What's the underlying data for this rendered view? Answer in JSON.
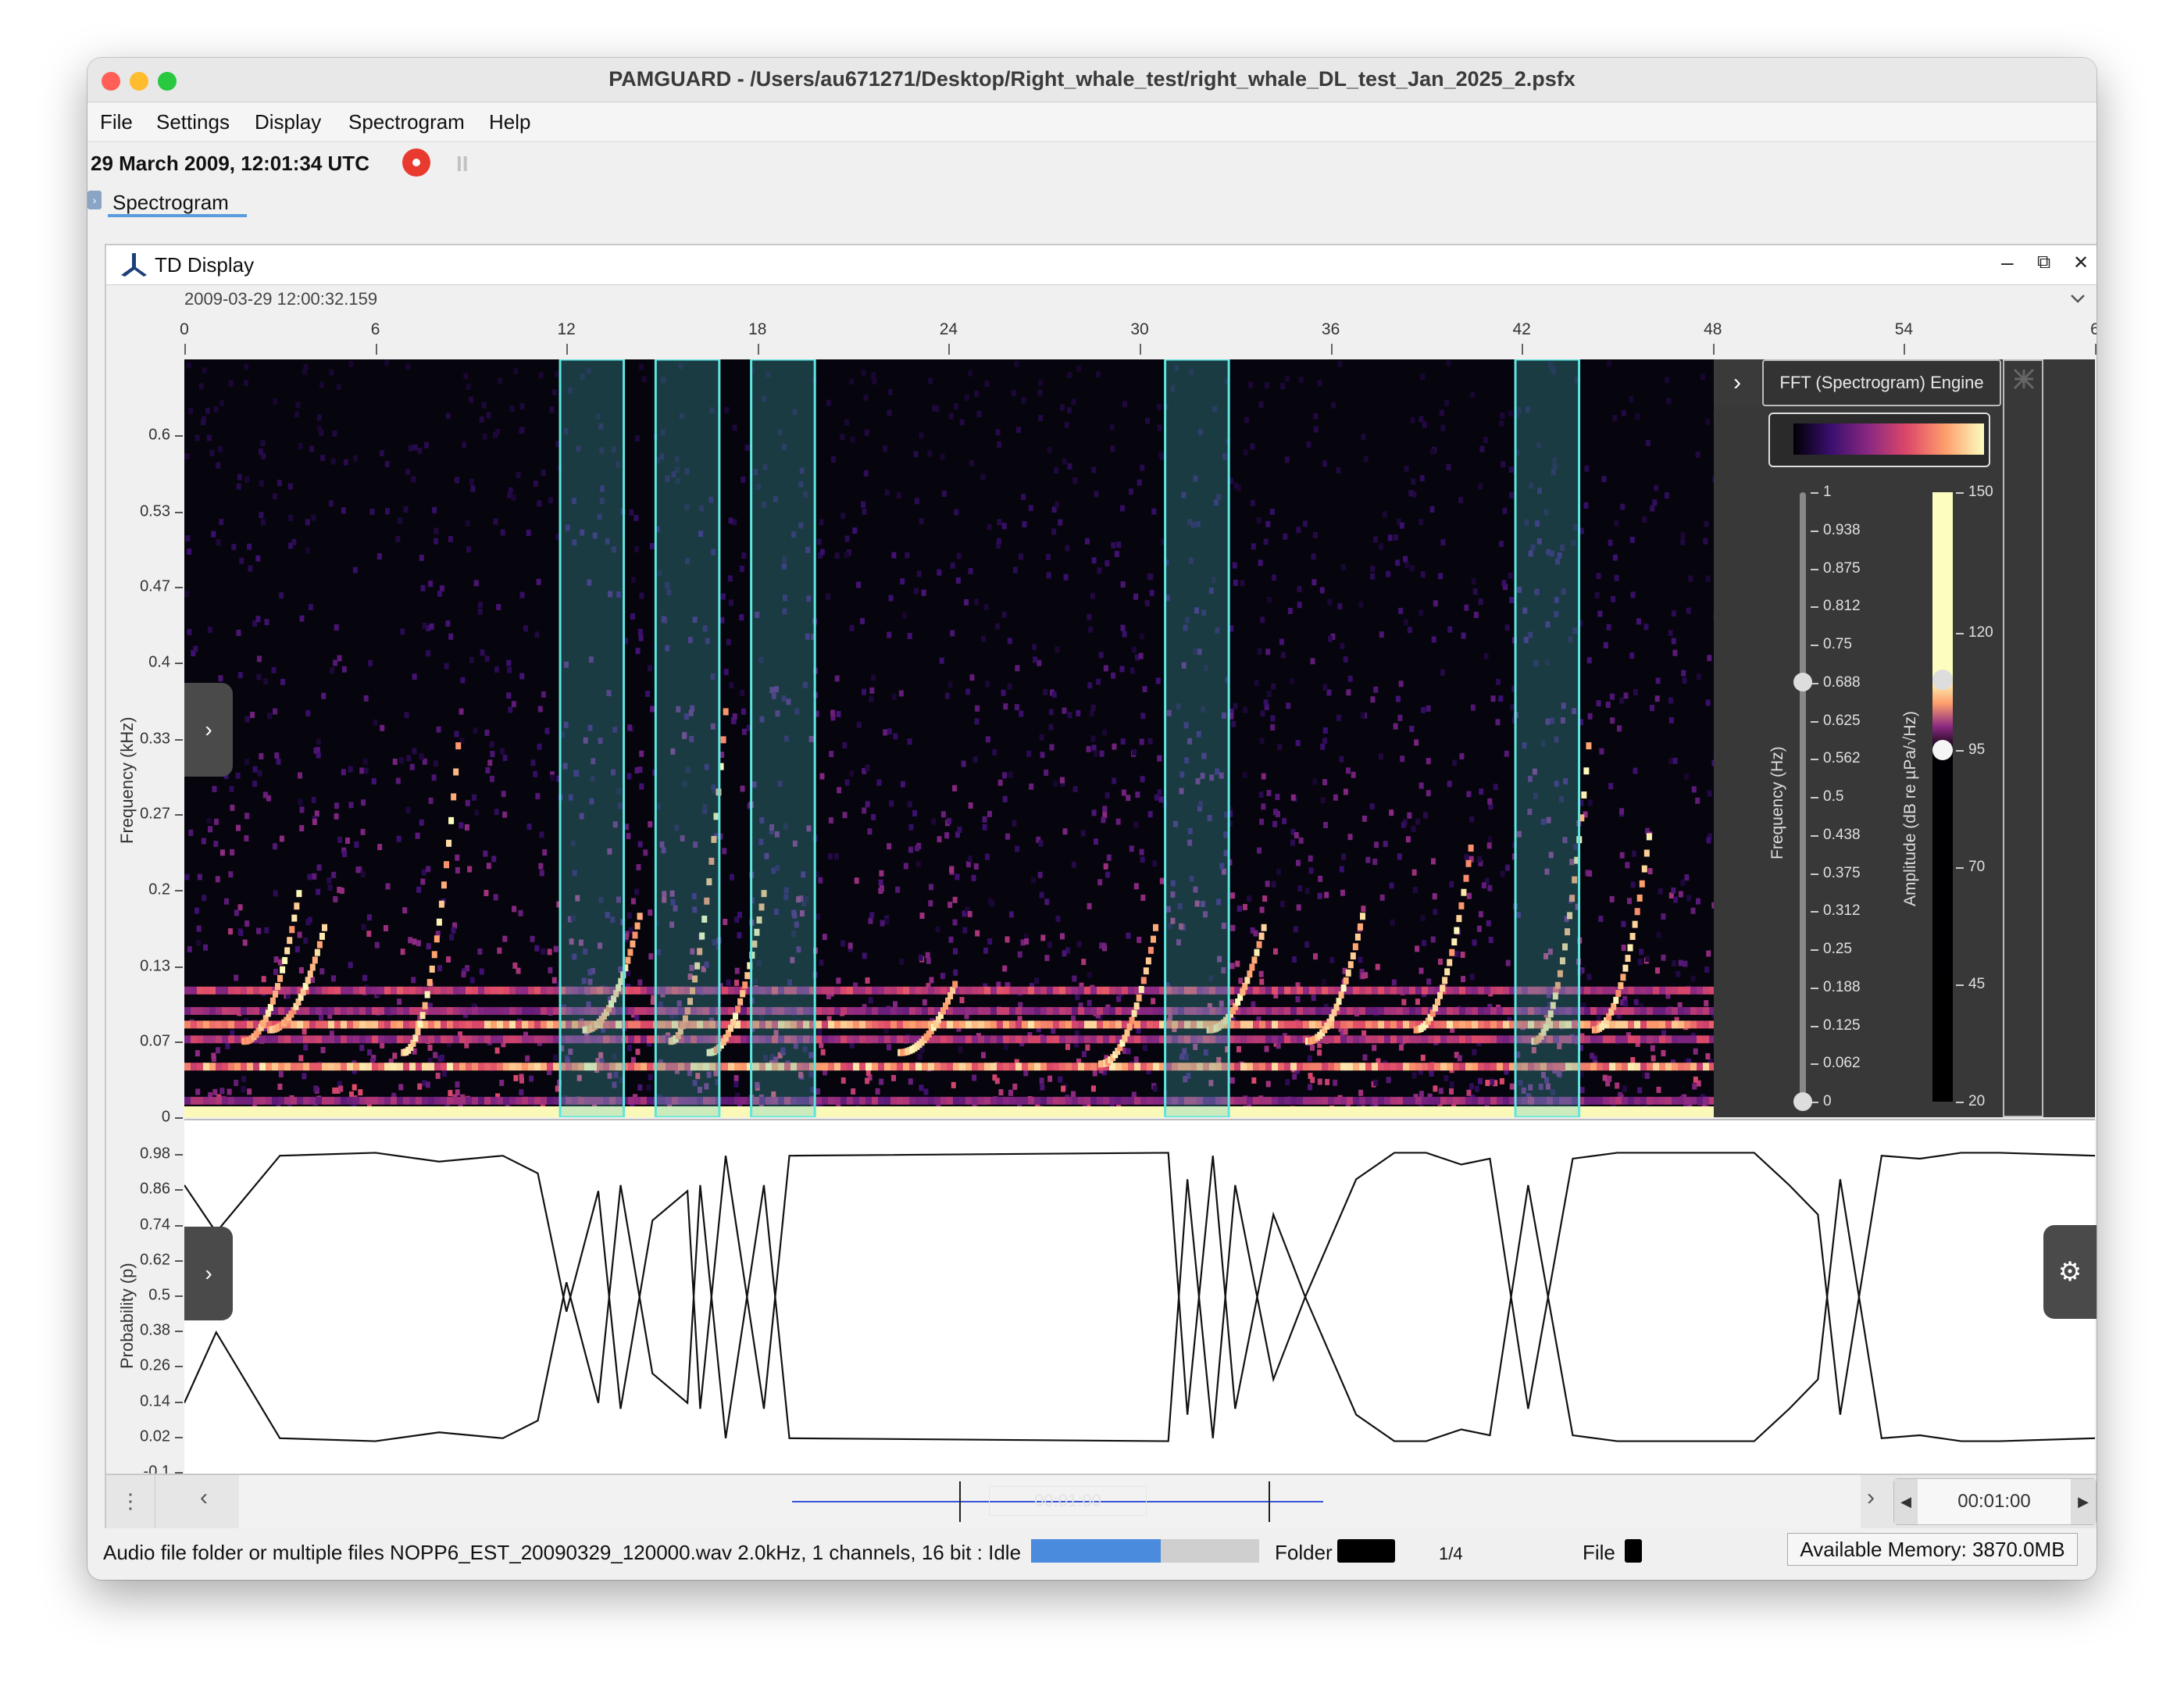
{
  "window": {
    "title": "PAMGUARD - /Users/au671271/Desktop/Right_whale_test/right_whale_DL_test_Jan_2025_2.psfx",
    "traffic_lights": {
      "close": "#ff5f57",
      "minimize": "#febc2e",
      "zoom": "#28c840"
    }
  },
  "menu": [
    "File",
    "Settings",
    "Display",
    "Spectrogram",
    "Help"
  ],
  "toolbar": {
    "datetime": "29 March 2009, 12:01:34 UTC",
    "record_icon": "record-icon",
    "pause_icon": "pause-icon",
    "pause_label": "II"
  },
  "tabs": [
    {
      "label": "Spectrogram",
      "active": true
    }
  ],
  "td_display": {
    "title": "TD Display",
    "start_time": "2009-03-29 12:00:32.159",
    "minimize": "–",
    "restore": "⧉",
    "close": "✕",
    "collapse_icon": "chevron-down-icon",
    "time_ticks": [
      0,
      6,
      12,
      18,
      24,
      30,
      36,
      42,
      48,
      54,
      6
    ],
    "time_tick_positions": [
      0,
      6,
      12,
      18,
      24,
      30,
      36,
      42,
      48,
      54,
      60
    ]
  },
  "spectrogram": {
    "y_label": "Frequency (kHz)",
    "y_ticks": [
      "0.6",
      "0.53",
      "0.47",
      "0.4",
      "0.33",
      "0.27",
      "0.2",
      "0.13",
      "0.07",
      "0"
    ],
    "y_tick_values": [
      0.6,
      0.533,
      0.467,
      0.4,
      0.333,
      0.267,
      0.2,
      0.133,
      0.067,
      0
    ],
    "y_max": 0.667,
    "time_max": 60,
    "detections_s": [
      [
        11.8,
        13.8
      ],
      [
        14.8,
        16.8
      ],
      [
        17.8,
        19.8
      ],
      [
        30.8,
        32.8
      ],
      [
        41.8,
        43.8
      ]
    ],
    "detection_color": "#5ee6e0",
    "colormap": [
      "#000004",
      "#3b0f70",
      "#8c2981",
      "#de4968",
      "#fe9f6d",
      "#fcfdbf"
    ]
  },
  "engine_panel": {
    "title": "FFT (Spectrogram) Engine",
    "expand_icon": "chevron-right-icon",
    "handle_icon": "drag-handle-icon",
    "freq_label": "Frequency (Hz)",
    "freq_ticks": [
      "1",
      "0.938",
      "0.875",
      "0.812",
      "0.75",
      "0.688",
      "0.625",
      "0.562",
      "0.5",
      "0.438",
      "0.375",
      "0.312",
      "0.25",
      "0.188",
      "0.125",
      "0.062",
      "0"
    ],
    "freq_slider_value": 0.688,
    "amp_label": "Amplitude (dB re µPa/√Hz)",
    "amp_ticks": [
      "150",
      "120",
      "95",
      "70",
      "45",
      "20"
    ],
    "amp_tick_values": [
      150,
      120,
      95,
      70,
      45,
      20
    ],
    "amp_high": 110,
    "amp_low": 95
  },
  "probability": {
    "y_label": "Probability (p)",
    "y_ticks": [
      "0.98",
      "0.86",
      "0.74",
      "0.62",
      "0.5",
      "0.38",
      "0.26",
      "0.14",
      "0.02",
      "-0.1"
    ],
    "y_tick_values": [
      0.98,
      0.86,
      0.74,
      0.62,
      0.5,
      0.38,
      0.26,
      0.14,
      0.02,
      -0.1
    ],
    "y_range": [
      -0.1,
      1.1
    ],
    "gear_icon": "gear-icon",
    "side_icon": "chevron-right-icon",
    "upper": [
      [
        0,
        0.88
      ],
      [
        1,
        0.72
      ],
      [
        3,
        0.98
      ],
      [
        6,
        0.99
      ],
      [
        8,
        0.96
      ],
      [
        10,
        0.98
      ],
      [
        11.1,
        0.92
      ],
      [
        12,
        0.45
      ],
      [
        13,
        0.86
      ],
      [
        13.7,
        0.12
      ],
      [
        14.7,
        0.76
      ],
      [
        15.8,
        0.86
      ],
      [
        16.2,
        0.12
      ],
      [
        17,
        0.98
      ],
      [
        18.2,
        0.12
      ],
      [
        19,
        0.98
      ],
      [
        30.9,
        0.99
      ],
      [
        31.5,
        0.1
      ],
      [
        32.3,
        0.98
      ],
      [
        33,
        0.12
      ],
      [
        34.2,
        0.78
      ],
      [
        35.2,
        0.5
      ],
      [
        36.8,
        0.9
      ],
      [
        38,
        0.99
      ],
      [
        39,
        0.99
      ],
      [
        40.1,
        0.95
      ],
      [
        41,
        0.97
      ],
      [
        42.2,
        0.12
      ],
      [
        43.6,
        0.97
      ],
      [
        45,
        0.99
      ],
      [
        47,
        0.99
      ],
      [
        49.3,
        0.99
      ],
      [
        50.4,
        0.88
      ],
      [
        51.3,
        0.78
      ],
      [
        52,
        0.1
      ],
      [
        53.3,
        0.98
      ],
      [
        54.5,
        0.97
      ],
      [
        55.8,
        0.99
      ],
      [
        57,
        0.99
      ],
      [
        60,
        0.98
      ]
    ],
    "lower": [
      [
        0,
        0.14
      ],
      [
        1,
        0.38
      ],
      [
        3,
        0.02
      ],
      [
        6,
        0.01
      ],
      [
        8,
        0.04
      ],
      [
        10,
        0.02
      ],
      [
        11.1,
        0.08
      ],
      [
        12,
        0.55
      ],
      [
        13,
        0.14
      ],
      [
        13.7,
        0.88
      ],
      [
        14.7,
        0.24
      ],
      [
        15.8,
        0.14
      ],
      [
        16.2,
        0.88
      ],
      [
        17,
        0.02
      ],
      [
        18.2,
        0.88
      ],
      [
        19,
        0.02
      ],
      [
        30.9,
        0.01
      ],
      [
        31.5,
        0.9
      ],
      [
        32.3,
        0.02
      ],
      [
        33,
        0.88
      ],
      [
        34.2,
        0.22
      ],
      [
        35.2,
        0.5
      ],
      [
        36.8,
        0.1
      ],
      [
        38,
        0.01
      ],
      [
        39,
        0.01
      ],
      [
        40.1,
        0.05
      ],
      [
        41,
        0.03
      ],
      [
        42.2,
        0.88
      ],
      [
        43.6,
        0.03
      ],
      [
        45,
        0.01
      ],
      [
        47,
        0.01
      ],
      [
        49.3,
        0.01
      ],
      [
        50.4,
        0.12
      ],
      [
        51.3,
        0.22
      ],
      [
        52,
        0.9
      ],
      [
        53.3,
        0.02
      ],
      [
        54.5,
        0.03
      ],
      [
        55.8,
        0.01
      ],
      [
        57,
        0.01
      ],
      [
        60,
        0.02
      ]
    ]
  },
  "scroller": {
    "menu_icon": "vertical-dots-icon",
    "left_icon": "chevron-left-icon",
    "right_icon": "chevron-right-icon",
    "duration_value": "00:01:00",
    "ghost_label": "00:01:00",
    "step_left_icon": "triangle-left-icon",
    "step_right_icon": "triangle-right-icon"
  },
  "status": {
    "text": "Audio file folder or multiple files NOPP6_EST_20090329_120000.wav 2.0kHz, 1 channels, 16 bit : Idle",
    "progress": 0.57,
    "folder_label": "Folder",
    "count": "1/4",
    "file_label": "File",
    "memory": "Available Memory: 3870.0MB"
  }
}
